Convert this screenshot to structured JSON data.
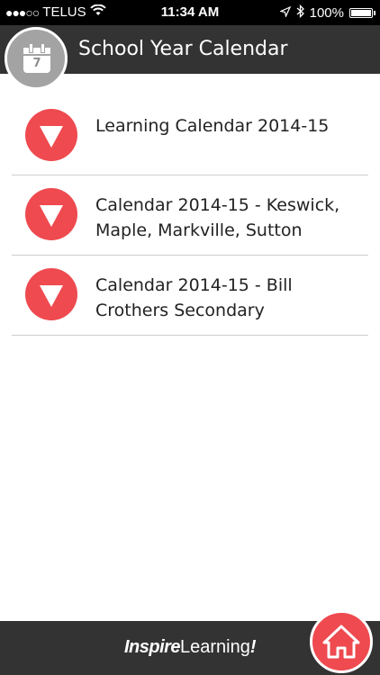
{
  "status_bar": {
    "signal": "●●●○○",
    "carrier": "TELUS",
    "time": "11:34 AM",
    "battery": "100%",
    "icons": [
      "wifi-icon",
      "location-arrow-icon",
      "bluetooth-icon",
      "battery-icon"
    ]
  },
  "header": {
    "title": "School Year Calendar",
    "calendar_day": "7",
    "icon": "calendar-icon"
  },
  "list": {
    "items": [
      {
        "label_line1": "Learning Calendar 2014-15",
        "label_line2": ""
      },
      {
        "label_line1": "Calendar 2014-15 - Keswick,",
        "label_line2": "Maple, Markville, Sutton"
      },
      {
        "label_line1": "Calendar 2014-15 - Bill",
        "label_line2": "Crothers Secondary"
      }
    ],
    "expand_icon": "triangle-down-icon"
  },
  "footer": {
    "brand_bold": "Inspire",
    "brand_light": "Learning",
    "brand_mark": "!",
    "home_icon": "home-icon"
  },
  "colors": {
    "accent": "#ee4a4f",
    "bar": "#333333",
    "badge": "#a3a3a3"
  }
}
